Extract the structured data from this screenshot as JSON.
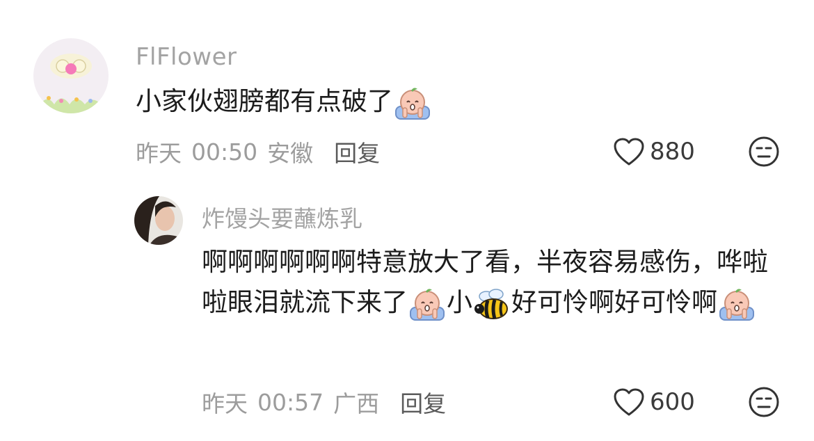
{
  "comments": [
    {
      "username": "FlFlower",
      "text_before": "小家伙翅膀都有点破了",
      "emoji_1": "crying-emoji",
      "date": "昨天",
      "time": "00:50",
      "location": "安徽",
      "reply_label": "回复",
      "likes": "880",
      "dislike_icon": "neutral-face-icon"
    },
    {
      "username": "炸馒头要蘸炼乳",
      "text_part1": "啊啊啊啊啊啊特意放大了看，半夜容易感伤，哗啦啦眼泪就流下来了",
      "text_part2": "小",
      "text_part3": "好可怜啊好可怜啊",
      "emoji_crying": "crying-emoji",
      "emoji_bee": "bee-emoji",
      "date": "昨天",
      "time": "00:57",
      "location": "广西",
      "reply_label": "回复",
      "likes": "600",
      "dislike_icon": "neutral-face-icon"
    }
  ],
  "colors": {
    "username": "#a3a3a3",
    "text": "#1c1c1c",
    "meta": "#9c9c9c",
    "reply": "#5a5a5a"
  }
}
